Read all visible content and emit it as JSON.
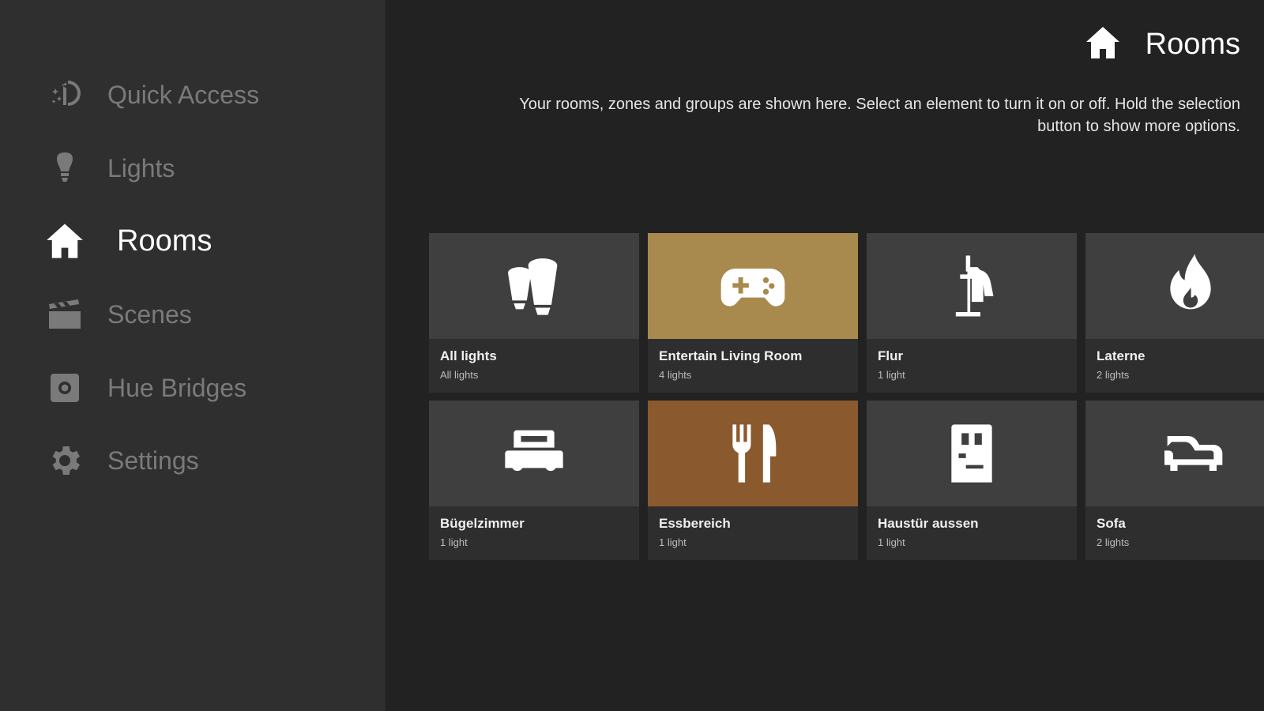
{
  "sidebar": {
    "items": [
      {
        "label": "Quick Access",
        "icon": "quick-access-icon"
      },
      {
        "label": "Lights",
        "icon": "bulb-icon"
      },
      {
        "label": "Rooms",
        "icon": "home-icon",
        "active": true
      },
      {
        "label": "Scenes",
        "icon": "clapperboard-icon"
      },
      {
        "label": "Hue Bridges",
        "icon": "bridge-icon"
      },
      {
        "label": "Settings",
        "icon": "gear-icon"
      }
    ]
  },
  "header": {
    "title": "Rooms",
    "icon": "home-icon",
    "description": "Your rooms, zones and groups are shown here. Select an element to turn it on or off. Hold the selection button to show more options."
  },
  "rooms": [
    {
      "name": "All lights",
      "count": "All lights",
      "icon": "bulbs-group-icon",
      "color": "#3f3f3f"
    },
    {
      "name": "Entertain Living Room",
      "count": "4 lights",
      "icon": "gamepad-icon",
      "color": "#a88a4e"
    },
    {
      "name": "Flur",
      "count": "1 light",
      "icon": "coat-rack-icon",
      "color": "#3f3f3f"
    },
    {
      "name": "Laterne",
      "count": "2 lights",
      "icon": "flame-icon",
      "color": "#3f3f3f"
    },
    {
      "name": "Bügelzimmer",
      "count": "1 light",
      "icon": "bed-icon",
      "color": "#3f3f3f"
    },
    {
      "name": "Essbereich",
      "count": "1 light",
      "icon": "cutlery-icon",
      "color": "#8a5a2e"
    },
    {
      "name": "Haustür aussen",
      "count": "1 light",
      "icon": "door-icon",
      "color": "#3f3f3f"
    },
    {
      "name": "Sofa",
      "count": "2 lights",
      "icon": "sofa-icon",
      "color": "#3f3f3f"
    }
  ]
}
